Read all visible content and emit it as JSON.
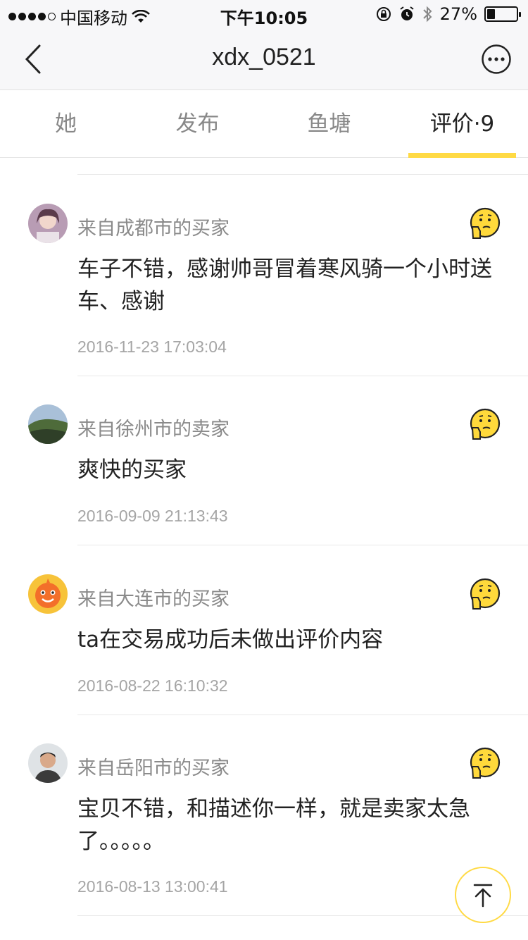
{
  "status_bar": {
    "carrier": "中国移动",
    "time": "下午10:05",
    "battery_percent_label": "27%",
    "battery_level": 0.27,
    "icons": [
      "wifi-icon",
      "orientation-lock-icon",
      "alarm-icon",
      "bluetooth-icon"
    ]
  },
  "nav": {
    "title": "xdx_0521",
    "back_icon": "chevron-left-icon",
    "more_icon": "more-icon"
  },
  "tabs": [
    {
      "label": "她",
      "active": false
    },
    {
      "label": "发布",
      "active": false
    },
    {
      "label": "鱼塘",
      "active": false
    },
    {
      "label": "评价·9",
      "active": true
    }
  ],
  "reviews": [
    {
      "from": "来自成都市的买家",
      "content": "车子不错，感谢帅哥冒着寒风骑一个小时送车、感谢",
      "date": "2016-11-23 17:03:04",
      "rating_icon": "thinking-face-icon"
    },
    {
      "from": "来自徐州市的卖家",
      "content": "爽快的买家",
      "date": "2016-09-09 21:13:43",
      "rating_icon": "thinking-face-icon"
    },
    {
      "from": "来自大连市的买家",
      "content": "ta在交易成功后未做出评价内容",
      "date": "2016-08-22 16:10:32",
      "rating_icon": "thinking-face-icon"
    },
    {
      "from": "来自岳阳市的买家",
      "content": "宝贝不错，和描述你一样，就是卖家太急了。。。。。",
      "date": "2016-08-13 13:00:41",
      "rating_icon": "thinking-face-icon"
    }
  ],
  "colors": {
    "accent": "#ffda44",
    "nav_bg": "#f7f7f9",
    "muted_text": "#8a8a8a"
  }
}
